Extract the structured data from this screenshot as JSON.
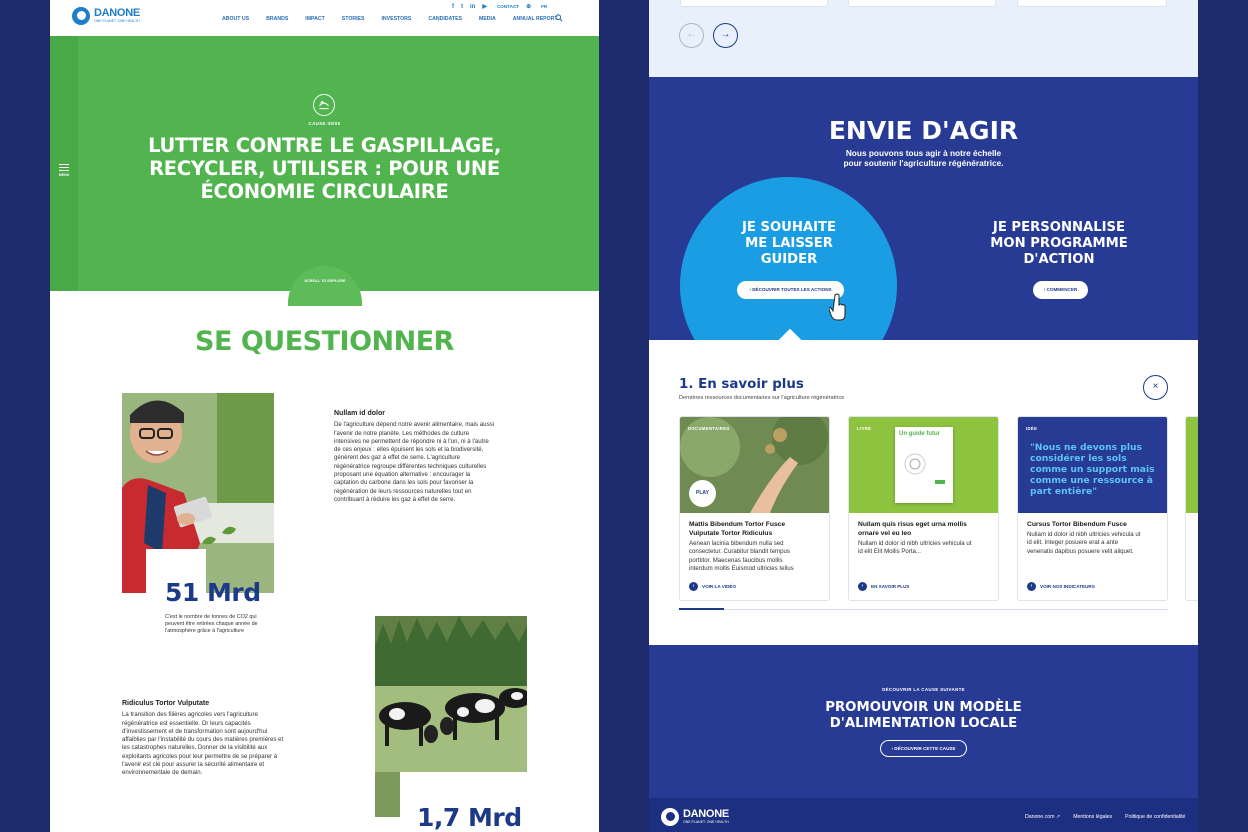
{
  "left": {
    "logo": {
      "word": "DANONE",
      "tagline": "ONE PLANET. ONE HEALTH"
    },
    "nav": [
      "ABOUT US",
      "BRANDS",
      "IMPACT",
      "STORIES",
      "INVESTORS",
      "CANDIDATES",
      "MEDIA",
      "ANNUAL REPORT"
    ],
    "social": {
      "facebook": "f",
      "twitter": "t",
      "linkedin": "in",
      "youtube": "▶",
      "contact": "CONTACT",
      "globe": "⊕",
      "lang": "FR"
    },
    "menu_label": "MENU",
    "hero": {
      "cause_label": "CAUSE 05/05",
      "title_lines": [
        "LUTTER CONTRE LE GASPILLAGE,",
        "RECYCLER, UTILISER : POUR UNE",
        "ÉCONOMIE CIRCULAIRE"
      ],
      "scroll_label": "SCROLL TO EXPLORE"
    },
    "section_title": "SE QUESTIONNER",
    "block1": {
      "heading": "Nullam id dolor",
      "lines": [
        "De l'agriculture dépend notre avenir alimentaire, mais aussi",
        "l'avenir de notre planète. Les méthodes de culture",
        "intensives ne permettent de répondre ni à l'un, ni à l'autre",
        "de ces enjeux : elles épuisent les sols et la biodiversité,",
        "génèrent des gaz à effet de serre. L'agriculture",
        "régénératrice regroupe différentes techniques culturelles",
        "proposant une équation alternative : encourager la",
        "captation du carbone dans les sols pour favoriser la",
        "régénération de leurs ressources naturelles tout en",
        "contribuant à réduire les gaz à effet de serre."
      ]
    },
    "stat1": {
      "value": "51 Mrd",
      "caption_lines": [
        "C'est le nombre de tonnes de CO2 qui",
        "peuvent être retirées chaque année de",
        "l'atmosphère grâce à l'agriculture"
      ]
    },
    "block2": {
      "heading": "Ridiculus Tortor Vulputate",
      "lines": [
        "La transition des filières agricoles vers l'agriculture",
        "régénératrice est essentielle. Or leurs capacités",
        "d'investissement et de transformation sont aujourd'hui",
        "affaiblies par l'instabilité du cours des matières premières et",
        "les catastrophes naturelles. Donner de la visibilité aux",
        "exploitants agricoles pour leur permettre de se préparer à",
        "l'avenir est clé pour assurer la sécurité alimentaire et",
        "environnementale de demain."
      ]
    },
    "stat2": {
      "value": "1,7 Mrd"
    }
  },
  "right": {
    "carousel": {
      "prev": "←",
      "next": "→"
    },
    "envie": {
      "title": "ENVIE D'AGIR",
      "subtitle_lines": [
        "Nous pouvons tous agir à notre échelle",
        "pour soutenir l'agriculture régénératrice."
      ],
      "choice1_lines": [
        "JE SOUHAITE",
        "ME LAISSER",
        "GUIDER"
      ],
      "choice1_button": "› DÉCOUVRIR TOUTES LES ACTIONS",
      "choice2_lines": [
        "JE PERSONNALISE",
        "MON PROGRAMME",
        "D'ACTION"
      ],
      "choice2_button": "› COMMENCER"
    },
    "savoir": {
      "title": "1. En savoir plus",
      "subtitle": "Dernières ressources documentaires sur l'agriculture régénératrice",
      "close": "×",
      "cards": [
        {
          "tag": "DOCUMENTAIRES",
          "play": "PLAY",
          "title_lines": [
            "Mattis Bibendum Tortor Fusce",
            "Vulputate Tortor Ridiculus"
          ],
          "desc_lines": [
            "Aenean lacinia bibendum nulla sed",
            "consectetur. Curabitur blandit tempus",
            "porttitor. Maecenas faucibus mollis",
            "interdum mollis Euismod ultricies tellus"
          ],
          "link": "VOIR LA VIDÉO"
        },
        {
          "tag": "LIVRE",
          "book_title": "Un guide futur",
          "title_lines": [
            "Nullam quis risus eget urna mollis",
            "ornare vel eu leo"
          ],
          "desc_lines": [
            "Nullam id dolor id nibh ultricies vehicula ut",
            "id elit Elit Mollis Porta..."
          ],
          "link": "EN SAVOIR PLUS"
        },
        {
          "tag": "IDÉE",
          "quote": "\"Nous ne devons plus considérer les sols comme un support mais comme une ressource à part entière\"",
          "title_lines": [
            "Cursus Tortor Bibendum Fusce"
          ],
          "desc_lines": [
            "Nullam id dolor id nibh ultricies vehicula ut",
            "id elit. Integer posuere erat a ante",
            "venenatis dapibus posuere velit aliquet."
          ],
          "link": "VOIR NOS INDICATEURS"
        }
      ]
    },
    "next_cause": {
      "label": "DÉCOUVRIR LA CAUSE SUIVANTE",
      "title_lines": [
        "PROMOUVOIR UN MODÈLE",
        "D'ALIMENTATION LOCALE"
      ],
      "button": "› DÉCOUVRIR CETTE CAUSE"
    },
    "footer": {
      "logo": {
        "word": "DANONE",
        "tagline": "ONE PLANET. ONE HEALTH"
      },
      "links": [
        "Danone.com ↗",
        "Mentions légales",
        "Politique de confidentialité"
      ]
    }
  },
  "colors": {
    "green": "#52b44f",
    "navy": "#273a94",
    "sky": "#1b9de3",
    "background": "#1d2a6b"
  }
}
